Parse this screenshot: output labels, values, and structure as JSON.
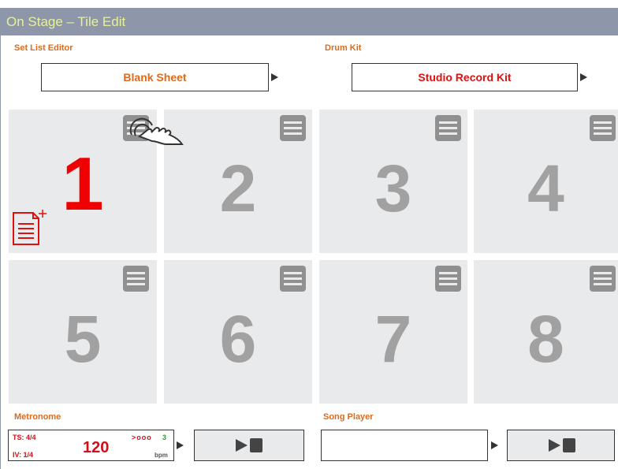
{
  "window": {
    "title": "On Stage – Tile Edit"
  },
  "setlist": {
    "label": "Set List Editor",
    "value": "Blank Sheet",
    "color": "#e06a1a"
  },
  "drumkit": {
    "label": "Drum Kit",
    "value": "Studio Record Kit",
    "color": "#e01010"
  },
  "tiles": [
    {
      "number": "1",
      "active": true
    },
    {
      "number": "2",
      "active": false
    },
    {
      "number": "3",
      "active": false
    },
    {
      "number": "4",
      "active": false
    },
    {
      "number": "5",
      "active": false
    },
    {
      "number": "6",
      "active": false
    },
    {
      "number": "7",
      "active": false
    },
    {
      "number": "8",
      "active": false
    }
  ],
  "icons": {
    "tile_menu": "hamburger-menu-icon",
    "new_document": "new-document-icon",
    "touch": "tap-gesture-icon",
    "play": "play-icon",
    "stop": "stop-icon"
  },
  "metronome": {
    "label": "Metronome",
    "time_signature": "TS: 4/4",
    "interval": "IV: 1/4",
    "tempo": "120",
    "beats": ">ooo",
    "beat_count": "3",
    "unit": "bpm"
  },
  "song_player": {
    "label": "Song Player",
    "value": ""
  },
  "colors": {
    "title_bar": "#8e96aa",
    "title_text": "#e7f09a",
    "label_orange": "#e06a1a",
    "active_red": "#f00000",
    "tile_bg": "#e9eaeb",
    "tile_number": "#a1a1a1"
  }
}
